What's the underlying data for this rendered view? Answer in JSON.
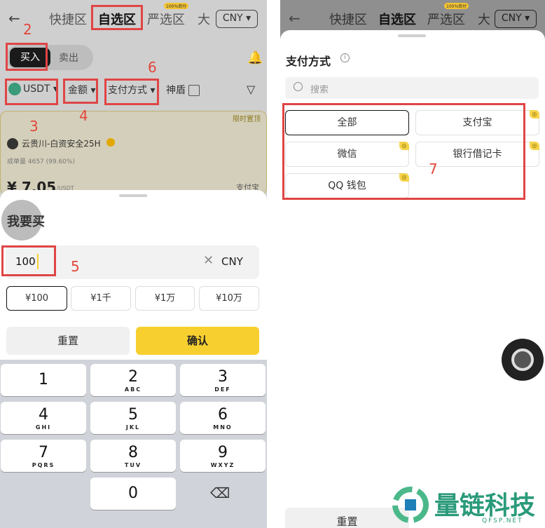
{
  "left": {
    "back_glyph": "←",
    "tabs": [
      {
        "label": "快捷区"
      },
      {
        "label": "自选区",
        "active": true
      },
      {
        "label": "严选区",
        "badge": "100%商付"
      }
    ],
    "big_label": "大",
    "currency_select": "CNY",
    "side_toggle": {
      "buy": "买入",
      "sell": "卖出"
    },
    "filters": {
      "coin": "USDT",
      "amount": "金额",
      "payment": "支付方式",
      "shield": "神盾"
    },
    "card": {
      "pinned": "限时置顶",
      "merchant": "云贵川-白资安全25H",
      "stats": "成单量 4657 (99.60%)",
      "price": "¥ 7.05",
      "price_unit": "/USDT",
      "payment": "支付宝"
    },
    "sheet": {
      "title": "我要买",
      "amount_value": "100",
      "currency": "CNY",
      "quick_amounts": [
        "¥100",
        "¥1千",
        "¥1万",
        "¥10万"
      ],
      "reset": "重置",
      "confirm": "确认"
    },
    "keypad": [
      {
        "num": "1",
        "letters": ""
      },
      {
        "num": "2",
        "letters": "ABC"
      },
      {
        "num": "3",
        "letters": "DEF"
      },
      {
        "num": "4",
        "letters": "GHI"
      },
      {
        "num": "5",
        "letters": "JKL"
      },
      {
        "num": "6",
        "letters": "MNO"
      },
      {
        "num": "7",
        "letters": "PQRS"
      },
      {
        "num": "8",
        "letters": "TUV"
      },
      {
        "num": "9",
        "letters": "WXYZ"
      },
      {
        "num": "0",
        "letters": ""
      }
    ],
    "backspace_glyph": "⌫"
  },
  "right": {
    "back_glyph": "←",
    "tabs": [
      {
        "label": "快捷区"
      },
      {
        "label": "自选区",
        "active": true
      },
      {
        "label": "严选区",
        "badge": "100%商付"
      }
    ],
    "big_label": "大",
    "currency_select": "CNY",
    "sheet": {
      "title": "支付方式",
      "search_placeholder": "搜索",
      "options": [
        {
          "label": "全部",
          "selected": true,
          "tag": false
        },
        {
          "label": "支付宝",
          "selected": false,
          "tag": true
        },
        {
          "label": "微信",
          "selected": false,
          "tag": true
        },
        {
          "label": "银行借记卡",
          "selected": false,
          "tag": true
        },
        {
          "label": "QQ 钱包",
          "selected": false,
          "tag": true
        }
      ],
      "reset": "重置"
    }
  },
  "annotations": [
    "2",
    "3",
    "4",
    "5",
    "6",
    "7"
  ],
  "watermark": {
    "name": "量链科技",
    "url": "QFSP.NET"
  },
  "colors": {
    "accent_yellow": "#f7cf2f",
    "annotation_red": "#e04545"
  }
}
